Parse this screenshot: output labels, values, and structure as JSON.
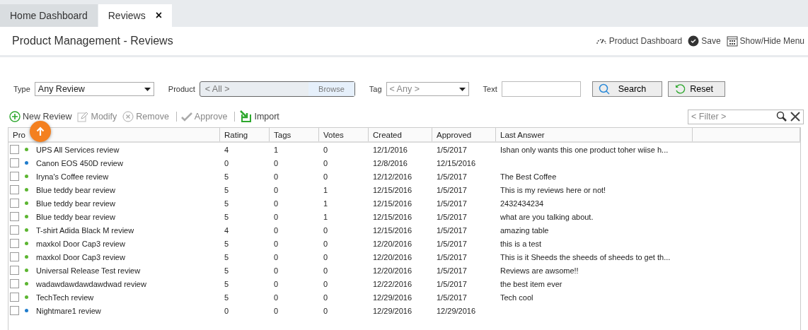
{
  "tabs": [
    {
      "label": "Home Dashboard",
      "selected": false
    },
    {
      "label": "Reviews",
      "selected": true,
      "close": "×"
    }
  ],
  "page_title": "Product Management - Reviews",
  "header_actions": [
    {
      "kind": "dashboard",
      "label": "Product Dashboard"
    },
    {
      "kind": "save",
      "label": "Save"
    },
    {
      "kind": "menu",
      "label": "Show/Hide Menu"
    }
  ],
  "filters": {
    "type": {
      "label": "Type",
      "value": "Any Review"
    },
    "product": {
      "label": "Product",
      "value": "< All >",
      "browse": "Browse"
    },
    "tag": {
      "label": "Tag",
      "value": "< Any >"
    },
    "text": {
      "label": "Text"
    },
    "search": "Search",
    "reset": "Reset"
  },
  "toolbar": [
    {
      "kind": "add",
      "label": "New Review",
      "disabled": false
    },
    {
      "kind": "edit",
      "label": "Modify",
      "disabled": true
    },
    {
      "kind": "remove",
      "label": "Remove",
      "disabled": true
    },
    {
      "kind": "approve",
      "label": "Approve",
      "disabled": true
    },
    {
      "kind": "import",
      "label": "Import",
      "disabled": false
    }
  ],
  "grid_filter": {
    "placeholder": "< Filter >"
  },
  "table": {
    "columns": [
      "Pro",
      "Rating",
      "Tags",
      "Votes",
      "Created",
      "Approved",
      "Last Answer"
    ],
    "rows": [
      {
        "checked": false,
        "color": "#5cb531",
        "product": "UPS All Services review",
        "rating": "4",
        "tags": "1",
        "votes": "0",
        "created": "12/1/2016",
        "approved": "1/5/2017",
        "last_answer": "Ishan only wants this one product toher wiise h..."
      },
      {
        "checked": false,
        "color": "#1f7ccc",
        "product": "Canon EOS 450D review",
        "rating": "0",
        "tags": "0",
        "votes": "0",
        "created": "12/8/2016",
        "approved": "12/15/2016"
      },
      {
        "checked": false,
        "color": "#5cb531",
        "product": "Iryna's Coffee review",
        "rating": "5",
        "tags": "0",
        "votes": "0",
        "created": "12/12/2016",
        "approved": "1/5/2017",
        "last_answer": "The Best Coffee"
      },
      {
        "checked": false,
        "color": "#5cb531",
        "product": "Blue teddy bear review",
        "rating": "5",
        "tags": "0",
        "votes": "1",
        "created": "12/15/2016",
        "approved": "1/5/2017",
        "last_answer": "This is my reviews here or not!"
      },
      {
        "checked": false,
        "color": "#5cb531",
        "product": "Blue teddy bear review",
        "rating": "5",
        "tags": "0",
        "votes": "1",
        "created": "12/15/2016",
        "approved": "1/5/2017",
        "last_answer": "2432434234"
      },
      {
        "checked": false,
        "color": "#5cb531",
        "product": "Blue teddy bear review",
        "rating": "5",
        "tags": "0",
        "votes": "1",
        "created": "12/15/2016",
        "approved": "1/5/2017",
        "last_answer": "what are you talking about."
      },
      {
        "checked": false,
        "color": "#5cb531",
        "product": "T-shirt Adida Black M review",
        "rating": "4",
        "tags": "0",
        "votes": "0",
        "created": "12/15/2016",
        "approved": "1/5/2017",
        "last_answer": "amazing table"
      },
      {
        "checked": false,
        "color": "#5cb531",
        "product": "maxkol Door Cap3 review",
        "rating": "5",
        "tags": "0",
        "votes": "0",
        "created": "12/20/2016",
        "approved": "1/5/2017",
        "last_answer": "this is a test"
      },
      {
        "checked": false,
        "color": "#5cb531",
        "product": "maxkol Door Cap3 review",
        "rating": "5",
        "tags": "0",
        "votes": "0",
        "created": "12/20/2016",
        "approved": "1/5/2017",
        "last_answer": "This is it Sheeds the sheeds of sheeds to get th..."
      },
      {
        "checked": false,
        "color": "#5cb531",
        "product": "Universal Release Test review",
        "rating": "5",
        "tags": "0",
        "votes": "0",
        "created": "12/20/2016",
        "approved": "1/5/2017",
        "last_answer": "Reviews are awsome!!"
      },
      {
        "checked": false,
        "color": "#5cb531",
        "product": "wadawdawdawdawdwad review",
        "rating": "5",
        "tags": "0",
        "votes": "0",
        "created": "12/22/2016",
        "approved": "1/5/2017",
        "last_answer": "the best item ever"
      },
      {
        "checked": false,
        "color": "#5cb531",
        "product": "TechTech review",
        "rating": "5",
        "tags": "0",
        "votes": "0",
        "created": "12/29/2016",
        "approved": "1/5/2017",
        "last_answer": "Tech cool"
      },
      {
        "checked": false,
        "color": "#1f7ccc",
        "product": "Nightmare1 review",
        "rating": "0",
        "tags": "0",
        "votes": "0",
        "created": "12/29/2016",
        "approved": "12/29/2016"
      }
    ]
  }
}
